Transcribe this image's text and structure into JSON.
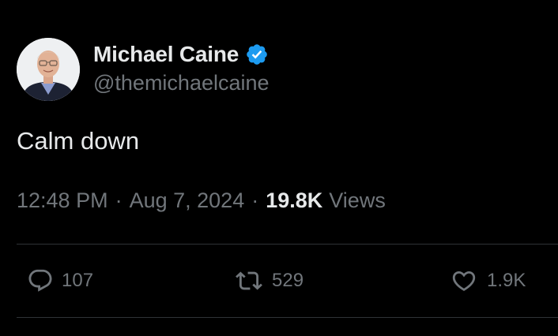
{
  "user": {
    "display_name": "Michael Caine",
    "handle": "@themichaelcaine",
    "verified": true,
    "verified_color": "#1d9bf0",
    "avatar_icon": "profile-photo"
  },
  "tweet": {
    "text": "Calm down"
  },
  "meta": {
    "time": "12:48 PM",
    "separator": "·",
    "date": "Aug 7, 2024",
    "views_count": "19.8K",
    "views_label": "Views"
  },
  "actions": {
    "reply": {
      "icon": "reply-icon",
      "count": "107"
    },
    "repost": {
      "icon": "repost-icon",
      "count": "529"
    },
    "like": {
      "icon": "heart-icon",
      "count": "1.9K"
    }
  },
  "colors": {
    "background": "#000000",
    "primary_text": "#e7e9ea",
    "secondary_text": "#71767b",
    "divider": "#2f3336"
  }
}
